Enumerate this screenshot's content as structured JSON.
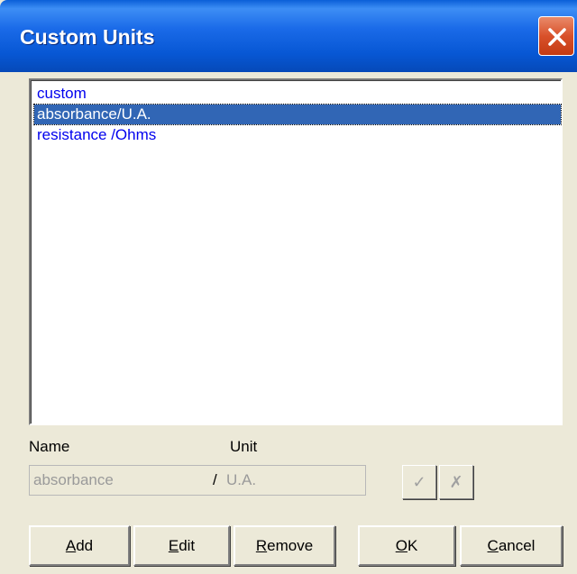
{
  "window": {
    "title": "Custom Units"
  },
  "list": {
    "items": [
      {
        "label": "custom",
        "selected": false
      },
      {
        "label": "absorbance/U.A.",
        "selected": true
      },
      {
        "label": "resistance /Ohms",
        "selected": false
      }
    ]
  },
  "form": {
    "name_label": "Name",
    "unit_label": "Unit",
    "name_value": "absorbance",
    "separator": "/",
    "unit_value": "U.A.",
    "confirm_glyph": "✓",
    "discard_glyph": "✗"
  },
  "buttons": {
    "add": {
      "accel": "A",
      "rest": "dd"
    },
    "edit": {
      "accel": "E",
      "rest": "dit"
    },
    "remove": {
      "accel": "R",
      "rest": "emove"
    },
    "ok": {
      "accel": "O",
      "rest": "K"
    },
    "cancel": {
      "accel": "C",
      "rest": "ancel"
    }
  },
  "colors": {
    "list_text": "#0000ee",
    "selection": "#3166b5",
    "title_bar": "#0757d4",
    "close_button": "#d9512a"
  },
  "icons": {
    "close": "close-icon",
    "confirm": "check-icon",
    "discard": "x-icon"
  }
}
